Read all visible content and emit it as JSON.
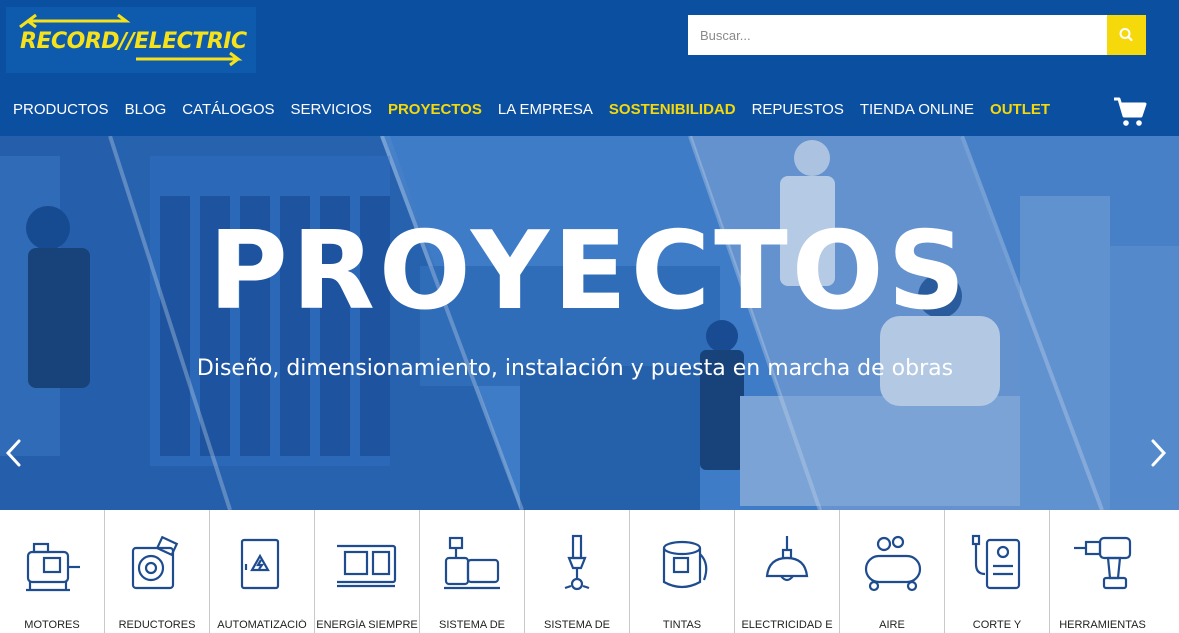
{
  "brand": {
    "logo_text": "RECORD∕∕ELECTRIC",
    "primary_color": "#0b4fa0",
    "accent_color": "#f5d90a"
  },
  "search": {
    "placeholder": "Buscar...",
    "icon": "search-icon"
  },
  "nav": {
    "items": [
      {
        "label": "PRODUCTOS",
        "highlight": false
      },
      {
        "label": "BLOG",
        "highlight": false
      },
      {
        "label": "CATÁLOGOS",
        "highlight": false
      },
      {
        "label": "SERVICIOS",
        "highlight": false
      },
      {
        "label": "PROYECTOS",
        "highlight": true
      },
      {
        "label": "LA EMPRESA",
        "highlight": false
      },
      {
        "label": "SOSTENIBILIDAD",
        "highlight": true
      },
      {
        "label": "REPUESTOS",
        "highlight": false
      },
      {
        "label": "TIENDA ONLINE",
        "highlight": false
      },
      {
        "label": "OUTLET",
        "highlight": true
      }
    ],
    "cart_icon": "shopping-cart-icon"
  },
  "hero": {
    "title": "PROYECTOS",
    "subtitle": "Diseño, dimensionamiento, instalación y puesta en marcha de obras",
    "prev_icon": "chevron-left-icon",
    "next_icon": "chevron-right-icon"
  },
  "categories": [
    {
      "label": "MOTORES",
      "icon": "motor-icon"
    },
    {
      "label": "REDUCTORES",
      "icon": "gear-reducer-icon"
    },
    {
      "label": "AUTOMATIZACIÓ",
      "icon": "electrical-panel-icon"
    },
    {
      "label": "ENERGÍA SIEMPRE",
      "icon": "generator-icon"
    },
    {
      "label": "SISTEMA DE",
      "icon": "pump-icon"
    },
    {
      "label": "SISTEMA DE",
      "icon": "spray-gun-icon"
    },
    {
      "label": "TINTAS",
      "icon": "paint-can-icon"
    },
    {
      "label": "ELECTRICIDAD E",
      "icon": "ceiling-lamp-icon"
    },
    {
      "label": "AIRE",
      "icon": "air-compressor-icon"
    },
    {
      "label": "CORTE Y",
      "icon": "welding-machine-icon"
    },
    {
      "label": "HERRAMIENTAS",
      "icon": "power-drill-icon"
    }
  ]
}
